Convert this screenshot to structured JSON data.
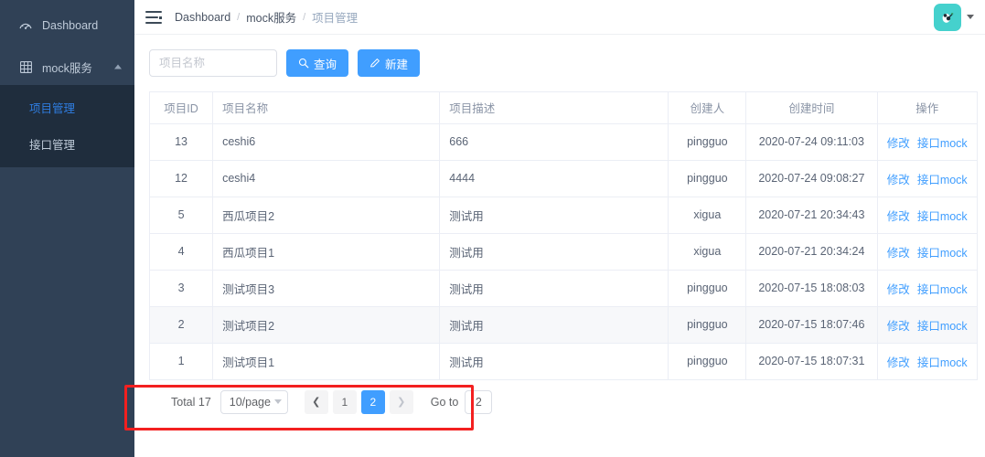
{
  "sidebar": {
    "items": [
      {
        "label": "Dashboard",
        "icon": "dashboard-icon",
        "active": false
      },
      {
        "label": "mock服务",
        "icon": "grid-icon",
        "active": false,
        "expanded": true
      }
    ],
    "submenu": [
      {
        "label": "项目管理",
        "active": true
      },
      {
        "label": "接口管理",
        "active": false
      }
    ],
    "bg_color": "#304156",
    "submenu_bg_color": "#1f2d3d",
    "active_color": "#2f7de1"
  },
  "header": {
    "menu_toggle_icon": "hamburger-icon",
    "breadcrumb": [
      {
        "label": "Dashboard",
        "current": false
      },
      {
        "label": "mock服务",
        "current": false
      },
      {
        "label": "项目管理",
        "current": true
      }
    ],
    "separator": "/",
    "avatar_icon": "user-avatar-icon",
    "avatar_color": "#45d1cd",
    "dropdown_icon": "caret-down-icon"
  },
  "toolbar": {
    "search_placeholder": "项目名称",
    "search_value": "",
    "search_button": {
      "label": "查询",
      "icon": "search-icon"
    },
    "create_button": {
      "label": "新建",
      "icon": "edit-pen-icon"
    },
    "button_color": "#409eff"
  },
  "table": {
    "columns": [
      {
        "key": "id",
        "label": "项目ID"
      },
      {
        "key": "name",
        "label": "项目名称"
      },
      {
        "key": "desc",
        "label": "项目描述"
      },
      {
        "key": "owner",
        "label": "创建人"
      },
      {
        "key": "time",
        "label": "创建时间"
      },
      {
        "key": "act",
        "label": "操作"
      }
    ],
    "actions": {
      "edit": "修改",
      "mock": "接口mock"
    },
    "rows": [
      {
        "id": "13",
        "name": "ceshi6",
        "desc": "666",
        "owner": "pingguo",
        "time": "2020-07-24 09:11:03",
        "highlight": false
      },
      {
        "id": "12",
        "name": "ceshi4",
        "desc": "4444",
        "owner": "pingguo",
        "time": "2020-07-24 09:08:27",
        "highlight": false
      },
      {
        "id": "5",
        "name": "西瓜项目2",
        "desc": "测试用",
        "owner": "xigua",
        "time": "2020-07-21 20:34:43",
        "highlight": false
      },
      {
        "id": "4",
        "name": "西瓜项目1",
        "desc": "测试用",
        "owner": "xigua",
        "time": "2020-07-21 20:34:24",
        "highlight": false
      },
      {
        "id": "3",
        "name": "测试项目3",
        "desc": "测试用",
        "owner": "pingguo",
        "time": "2020-07-15 18:08:03",
        "highlight": false
      },
      {
        "id": "2",
        "name": "测试项目2",
        "desc": "测试用",
        "owner": "pingguo",
        "time": "2020-07-15 18:07:46",
        "highlight": true
      },
      {
        "id": "1",
        "name": "测试项目1",
        "desc": "测试用",
        "owner": "pingguo",
        "time": "2020-07-15 18:07:31",
        "highlight": false
      }
    ]
  },
  "pagination": {
    "total_label": "Total 17",
    "page_size_label": "10/page",
    "prev_icon": "chevron-left-icon",
    "next_icon": "chevron-right-icon",
    "pages": [
      {
        "label": "1",
        "active": false
      },
      {
        "label": "2",
        "active": true
      }
    ],
    "goto_label": "Go to",
    "goto_value": "2",
    "active_color": "#409eff"
  },
  "annotation": {
    "color": "#f32020"
  }
}
